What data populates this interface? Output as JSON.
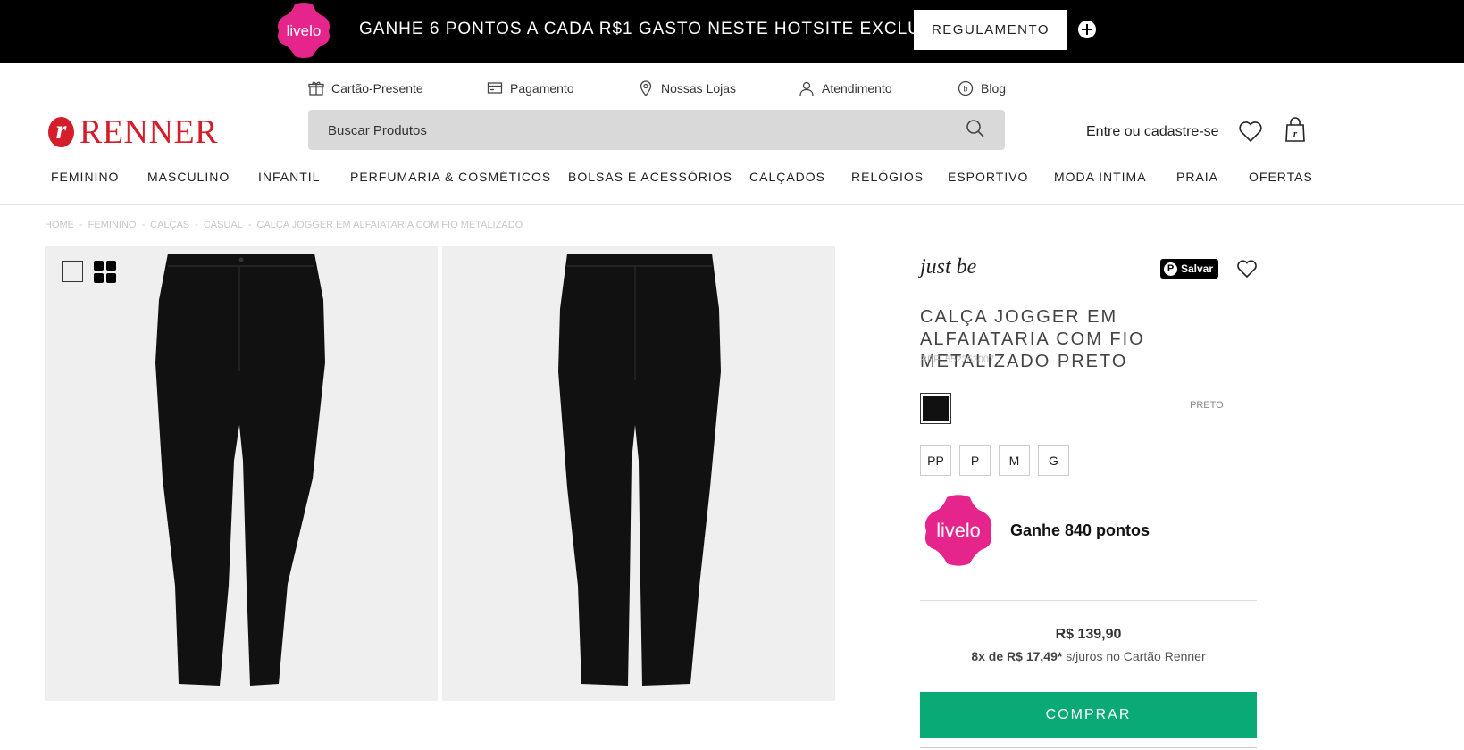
{
  "promo": {
    "logo_text": "livelo",
    "message": "GANHE 6 PONTOS A CADA R$1 GASTO NESTE HOTSITE EXCLUSIVO",
    "button_label": "REGULAMENTO",
    "expand_icon": "plus-circle-icon"
  },
  "utility_links": [
    {
      "label": "Cartão-Presente",
      "icon": "gift-icon"
    },
    {
      "label": "Pagamento",
      "icon": "payment-icon"
    },
    {
      "label": "Nossas Lojas",
      "icon": "location-pin-icon"
    },
    {
      "label": "Atendimento",
      "icon": "user-icon"
    },
    {
      "label": "Blog",
      "icon": "blog-icon"
    }
  ],
  "header": {
    "logo_letter": "r",
    "logo_text": "RENNER",
    "search_placeholder": "Buscar Produtos",
    "account_label": "Entre ou cadastre-se",
    "brand_color": "#d41e2c"
  },
  "nav": [
    "FEMININO",
    "MASCULINO",
    "INFANTIL",
    "PERFUMARIA & COSMÉTICOS",
    "BOLSAS E ACESSÓRIOS",
    "CALÇADOS",
    "RELÓGIOS",
    "ESPORTIVO",
    "MODA ÍNTIMA",
    "PRAIA",
    "OFERTAS"
  ],
  "breadcrumb": [
    "HOME",
    "FEMININO",
    "CALÇAS",
    "CASUAL",
    "CALÇA JOGGER EM ALFAIATARIA COM FIO METALIZADO"
  ],
  "breadcrumb_separator": "-",
  "product": {
    "brand": "just be",
    "pinterest_label": "Salvar",
    "title": "CALÇA JOGGER EM ALFAIATARIA COM FIO METALIZADO PRETO",
    "ref": "REF: 552353007",
    "color_name": "PRETO",
    "color_hex": "#111111",
    "sizes": [
      "PP",
      "P",
      "M",
      "G"
    ],
    "livelo_logo_text": "livelo",
    "points_label": "Ganhe 840 pontos",
    "price": "R$ 139,90",
    "installment_prefix": "8x de",
    "installment_value": "R$ 17,49*",
    "installment_suffix": "s/juros no Cartão Renner",
    "buy_label": "COMPRAR",
    "buy_color": "#0aaa77"
  }
}
